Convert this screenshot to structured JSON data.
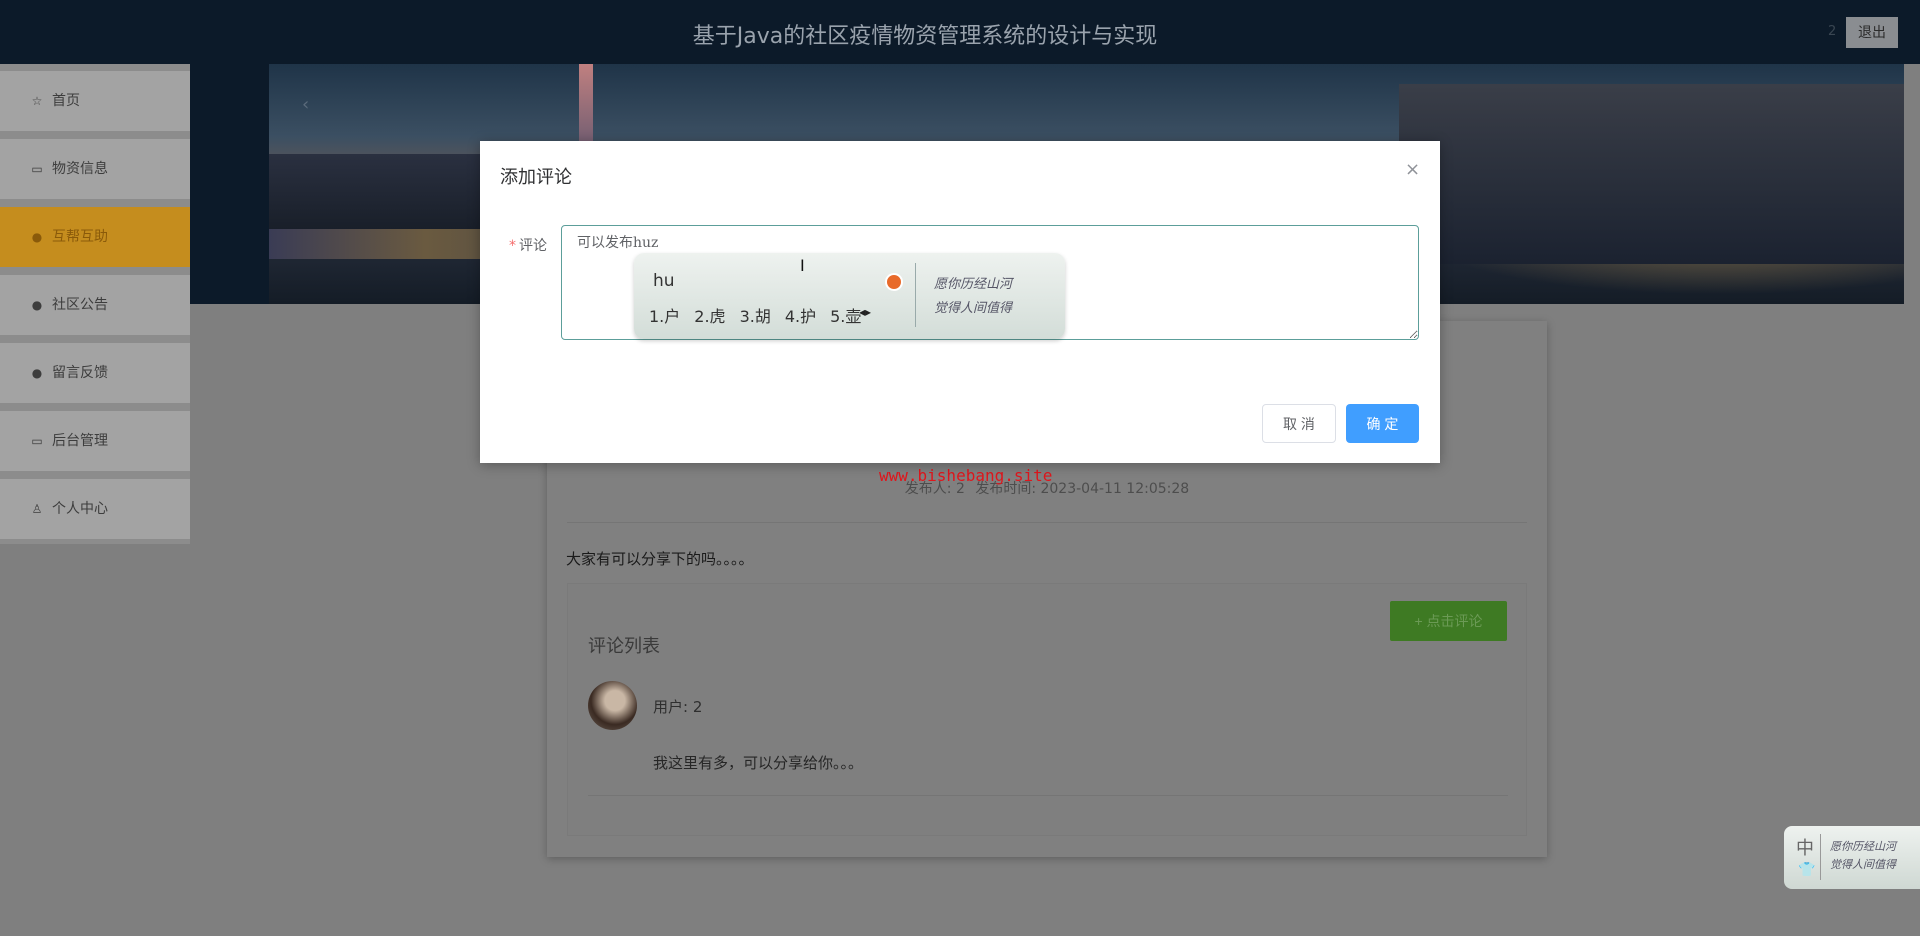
{
  "header": {
    "title": "基于Java的社区疫情物资管理系统的设计与实现",
    "user": "2",
    "logout_label": "退出"
  },
  "sidebar": {
    "items": [
      {
        "label": "首页",
        "icon": "☆"
      },
      {
        "label": "物资信息",
        "icon": "▭"
      },
      {
        "label": "互帮互助",
        "icon": "●",
        "active": true
      },
      {
        "label": "社区公告",
        "icon": "●"
      },
      {
        "label": "留言反馈",
        "icon": "●"
      },
      {
        "label": "后台管理",
        "icon": "▭"
      },
      {
        "label": "个人中心",
        "icon": "♙"
      }
    ]
  },
  "banner": {
    "prev_icon": "‹"
  },
  "post": {
    "publisher_label": "发布人: 2",
    "time_label": "发布时间: 2023-04-11 12:05:28",
    "content": "大家有可以分享下的吗。。。。",
    "comments_title": "评论列表",
    "add_comment_label": "+ 点击评论",
    "comments": [
      {
        "user": "用户: 2",
        "text": "我这里有多，可以分享给你。。。"
      }
    ]
  },
  "watermark": "www.bishebang.site",
  "dialog": {
    "title": "添加评论",
    "close_icon": "×",
    "field_label": "评论",
    "required_mark": "*",
    "field_value": "可以发布huz",
    "cancel_label": "取 消",
    "confirm_label": "确 定"
  },
  "ime": {
    "composition": "hu",
    "candidates": [
      "1.户",
      "2.虎",
      "3.胡",
      "4.护",
      "5.壶"
    ],
    "page_arrows": "◂▸",
    "mode": "中",
    "art_text": [
      "愿你历经山河",
      "觉得人间值得"
    ]
  },
  "colors": {
    "accent": "#409eff",
    "active_nav": "#c58d1e",
    "comment_button": "#3e7a23",
    "watermark": "#e0161c"
  }
}
